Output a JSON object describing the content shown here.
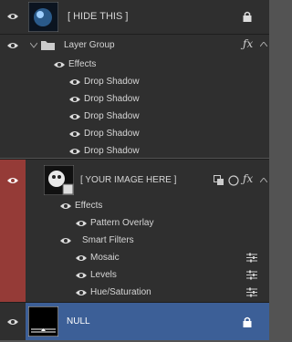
{
  "layers": {
    "hide_this": {
      "name": "[ HIDE THIS ]"
    },
    "group": {
      "name": "Layer Group",
      "effects_label": "Effects"
    },
    "group_effects": [
      "Drop Shadow",
      "Drop Shadow",
      "Drop Shadow",
      "Drop Shadow",
      "Drop Shadow"
    ],
    "image": {
      "name": "[ YOUR IMAGE HERE ]",
      "effects_label": "Effects",
      "pattern_overlay": "Pattern Overlay",
      "smart_filters_label": "Smart Filters"
    },
    "smart_filters": [
      "Mosaic",
      "Levels",
      "Hue/Saturation"
    ],
    "null_layer": {
      "name": "NULL"
    }
  },
  "colors": {
    "panel": "#2f2f2f",
    "selected_red": "#953b37",
    "selected_blue": "#3c5f97"
  }
}
